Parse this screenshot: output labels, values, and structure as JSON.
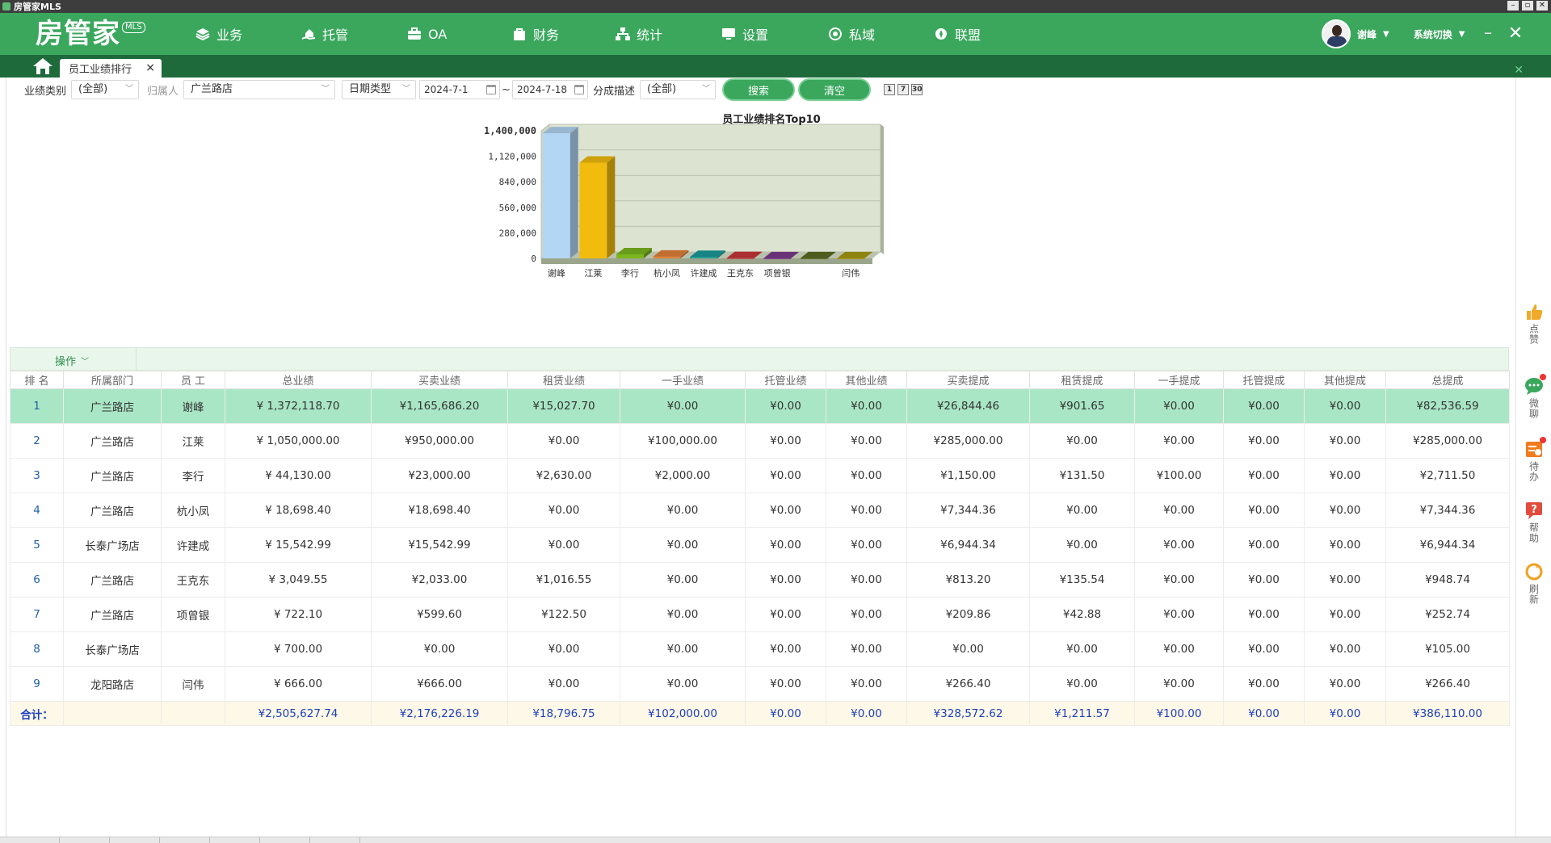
{
  "window": {
    "title": "房管家MLS",
    "controls": [
      "–",
      "▫",
      "✕"
    ]
  },
  "logo": {
    "text": "房管家",
    "badge": "MLS"
  },
  "nav": [
    {
      "label": "业务",
      "icon": "layers-icon"
    },
    {
      "label": "托管",
      "icon": "hand-house-icon"
    },
    {
      "label": "OA",
      "icon": "briefcase-icon"
    },
    {
      "label": "财务",
      "icon": "bag-icon"
    },
    {
      "label": "统计",
      "icon": "org-chart-icon"
    },
    {
      "label": "设置",
      "icon": "monitor-icon"
    },
    {
      "label": "私域",
      "icon": "eye-icon"
    },
    {
      "label": "联盟",
      "icon": "compass-icon"
    }
  ],
  "user": {
    "name": "谢峰",
    "switch_label": "系统切换"
  },
  "tabs": [
    {
      "label": "员工业绩排行",
      "close": "×"
    }
  ],
  "filters": {
    "category_label": "业绩类别",
    "category_value": "(全部)",
    "owner_label": "归属人",
    "owner_value": "广兰路店",
    "date_type": "日期类型",
    "date_from": "2024-7-1",
    "date_sep": "~",
    "date_to": "2024-7-18",
    "split_label": "分成描述",
    "split_value": "(全部)",
    "search_btn": "搜索",
    "clear_btn": "清空",
    "mini_buttons": [
      "1",
      "7",
      "30"
    ]
  },
  "chart_data": {
    "type": "bar",
    "title": "员工业绩排名Top10",
    "categories": [
      "谢峰",
      "江莱",
      "李行",
      "杭小凤",
      "许建成",
      "王克东",
      "项曾银",
      "",
      "闫伟"
    ],
    "values": [
      1372118.7,
      1050000.0,
      44130.0,
      18698.4,
      15542.99,
      3049.55,
      722.1,
      700.0,
      666.0
    ],
    "colors": [
      "#b4d6f5",
      "#f2bc0e",
      "#7bb61f",
      "#e3823a",
      "#1b9c9a",
      "#c9363a",
      "#7b3b8c",
      "#5a6b22",
      "#a89a12"
    ],
    "ylim": [
      0,
      1400000
    ],
    "yticks": [
      "0",
      "280,000",
      "560,000",
      "840,000",
      "1,120,000",
      "1,400,000"
    ],
    "ytick_values": [
      0,
      280000,
      560000,
      840000,
      1120000,
      1400000
    ],
    "grid": true
  },
  "grid": {
    "ops_label": "操作",
    "columns": [
      "排 名",
      "所属部门",
      "员 工",
      "总业绩",
      "买卖业绩",
      "租赁业绩",
      "一手业绩",
      "托管业绩",
      "其他业绩",
      "买卖提成",
      "租赁提成",
      "一手提成",
      "托管提成",
      "其他提成",
      "总提成"
    ],
    "rows": [
      [
        "1",
        "广兰路店",
        "谢峰",
        "¥ 1,372,118.70",
        "¥1,165,686.20",
        "¥15,027.70",
        "¥0.00",
        "¥0.00",
        "¥0.00",
        "¥26,844.46",
        "¥901.65",
        "¥0.00",
        "¥0.00",
        "¥0.00",
        "¥82,536.59"
      ],
      [
        "2",
        "广兰路店",
        "江莱",
        "¥ 1,050,000.00",
        "¥950,000.00",
        "¥0.00",
        "¥100,000.00",
        "¥0.00",
        "¥0.00",
        "¥285,000.00",
        "¥0.00",
        "¥0.00",
        "¥0.00",
        "¥0.00",
        "¥285,000.00"
      ],
      [
        "3",
        "广兰路店",
        "李行",
        "¥ 44,130.00",
        "¥23,000.00",
        "¥2,630.00",
        "¥2,000.00",
        "¥0.00",
        "¥0.00",
        "¥1,150.00",
        "¥131.50",
        "¥100.00",
        "¥0.00",
        "¥0.00",
        "¥2,711.50"
      ],
      [
        "4",
        "广兰路店",
        "杭小凤",
        "¥ 18,698.40",
        "¥18,698.40",
        "¥0.00",
        "¥0.00",
        "¥0.00",
        "¥0.00",
        "¥7,344.36",
        "¥0.00",
        "¥0.00",
        "¥0.00",
        "¥0.00",
        "¥7,344.36"
      ],
      [
        "5",
        "长泰广场店",
        "许建成",
        "¥ 15,542.99",
        "¥15,542.99",
        "¥0.00",
        "¥0.00",
        "¥0.00",
        "¥0.00",
        "¥6,944.34",
        "¥0.00",
        "¥0.00",
        "¥0.00",
        "¥0.00",
        "¥6,944.34"
      ],
      [
        "6",
        "广兰路店",
        "王克东",
        "¥ 3,049.55",
        "¥2,033.00",
        "¥1,016.55",
        "¥0.00",
        "¥0.00",
        "¥0.00",
        "¥813.20",
        "¥135.54",
        "¥0.00",
        "¥0.00",
        "¥0.00",
        "¥948.74"
      ],
      [
        "7",
        "广兰路店",
        "项曾银",
        "¥ 722.10",
        "¥599.60",
        "¥122.50",
        "¥0.00",
        "¥0.00",
        "¥0.00",
        "¥209.86",
        "¥42.88",
        "¥0.00",
        "¥0.00",
        "¥0.00",
        "¥252.74"
      ],
      [
        "8",
        "长泰广场店",
        "",
        "¥ 700.00",
        "¥0.00",
        "¥0.00",
        "¥0.00",
        "¥0.00",
        "¥0.00",
        "¥0.00",
        "¥0.00",
        "¥0.00",
        "¥0.00",
        "¥0.00",
        "¥105.00"
      ],
      [
        "9",
        "龙阳路店",
        "闫伟",
        "¥ 666.00",
        "¥666.00",
        "¥0.00",
        "¥0.00",
        "¥0.00",
        "¥0.00",
        "¥266.40",
        "¥0.00",
        "¥0.00",
        "¥0.00",
        "¥0.00",
        "¥266.40"
      ]
    ],
    "selected_row": 0,
    "total": [
      "合计：",
      "",
      "",
      "¥2,505,627.74",
      "¥2,176,226.19",
      "¥18,796.75",
      "¥102,000.00",
      "¥0.00",
      "¥0.00",
      "¥328,572.62",
      "¥1,211.57",
      "¥100.00",
      "¥0.00",
      "¥0.00",
      "¥386,110.00"
    ]
  },
  "dock": [
    {
      "label": "点赞",
      "icon": "thumbs-up-icon",
      "color": "#f2a92a",
      "dot": false
    },
    {
      "label": "微聊",
      "icon": "chat-icon",
      "color": "#3aa75d",
      "dot": true
    },
    {
      "label": "待办",
      "icon": "todo-icon",
      "color": "#f07c1e",
      "dot": true
    },
    {
      "label": "帮助",
      "icon": "help-icon",
      "color": "#e34c3c",
      "dot": false
    },
    {
      "label": "刷新",
      "icon": "refresh-icon",
      "color": "#f0a020",
      "dot": false
    }
  ]
}
